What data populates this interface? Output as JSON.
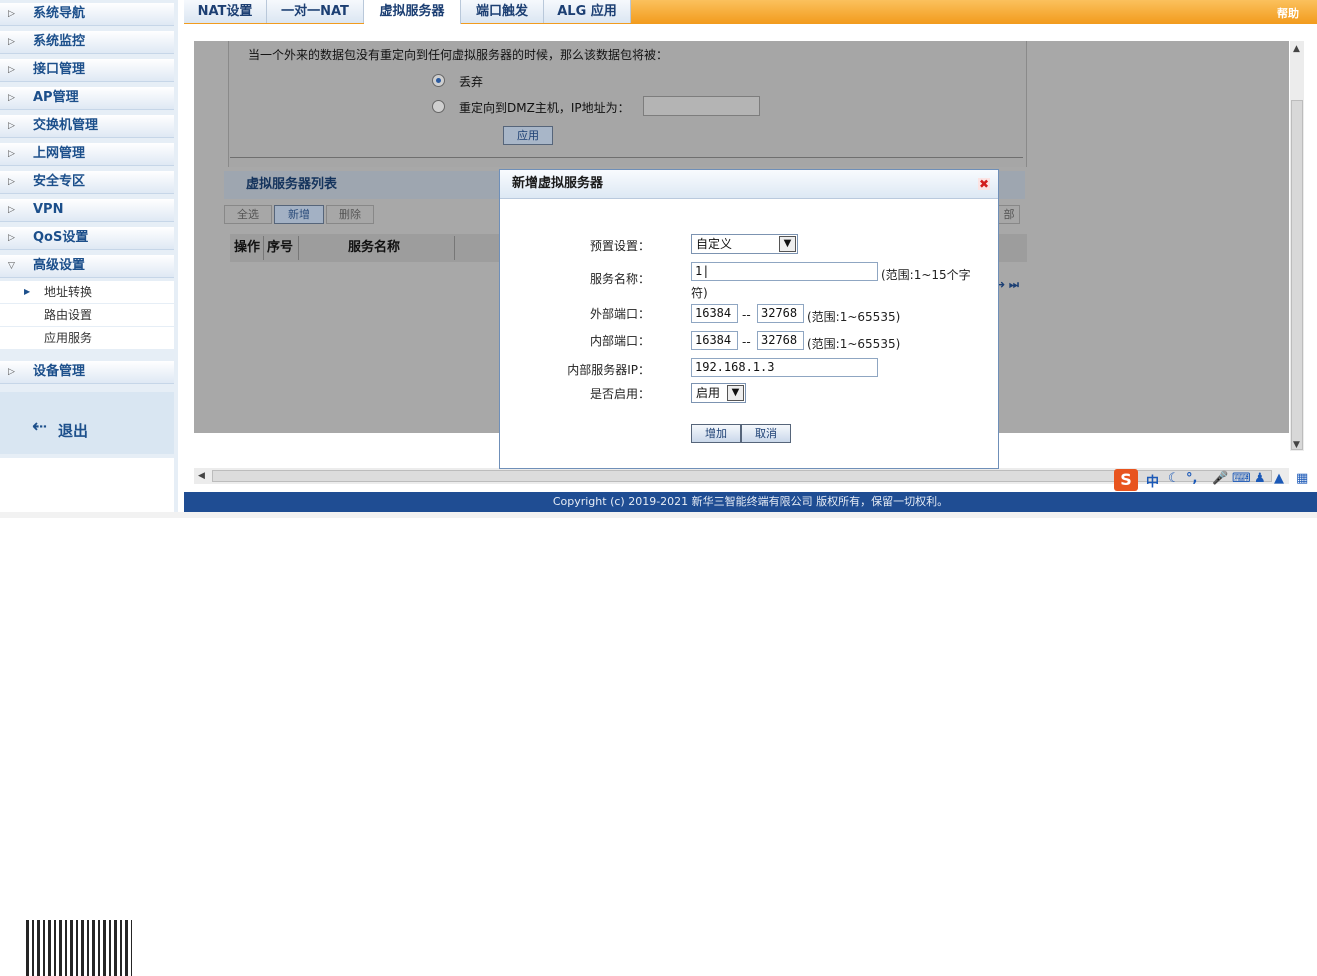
{
  "sidebar": {
    "items": [
      {
        "label": "系统导航"
      },
      {
        "label": "系统监控"
      },
      {
        "label": "接口管理"
      },
      {
        "label": "AP管理"
      },
      {
        "label": "交换机管理"
      },
      {
        "label": "上网管理"
      },
      {
        "label": "安全专区"
      },
      {
        "label": "VPN"
      },
      {
        "label": "QoS设置"
      },
      {
        "label": "高级设置"
      }
    ],
    "sub_items": [
      {
        "label": "地址转换"
      },
      {
        "label": "路由设置"
      },
      {
        "label": "应用服务"
      }
    ],
    "device_mgmt": "设备管理",
    "logout": "退出"
  },
  "tabs": [
    {
      "label": "NAT设置"
    },
    {
      "label": "一对一NAT"
    },
    {
      "label": "虚拟服务器"
    },
    {
      "label": "端口触发"
    },
    {
      "label": "ALG 应用"
    }
  ],
  "help": "帮助",
  "dmz": {
    "prompt": "当一个外来的数据包没有重定向到任何虚拟服务器的时候，那么该数据包将被：",
    "option_drop": "丢弃",
    "option_redirect": "重定向到DMZ主机，IP地址为：",
    "apply": "应用"
  },
  "list": {
    "title": "虚拟服务器列表",
    "btn_select_all": "全选",
    "btn_add": "新增",
    "btn_delete": "删除",
    "btn_right_partial": "部",
    "col_op": "操作",
    "col_no": "序号",
    "col_name": "服务名称",
    "pager": "➜ ⏭"
  },
  "modal": {
    "title": "新增虚拟服务器",
    "preset_label": "预置设置：",
    "preset_value": "自定义",
    "name_label": "服务名称：",
    "name_value": "1|",
    "name_hint_1": "(范围:1~15个字",
    "name_hint_2": "符)",
    "ext_port_label": "外部端口：",
    "ext_port_from": "16384",
    "ext_port_to": "32768",
    "int_port_label": "内部端口：",
    "int_port_from": "16384",
    "int_port_to": "32768",
    "dash": "--",
    "port_hint": "(范围:1~65535)",
    "ip_label": "内部服务器IP：",
    "ip_value": "192.168.1.3",
    "enable_label": "是否启用：",
    "enable_value": "启用",
    "add_button": "增加",
    "cancel_button": "取消"
  },
  "footer": {
    "copyright": "Copyright (c) 2019-2021 新华三智能终端有限公司 版权所有，保留一切权利。"
  },
  "ime": {
    "logo": "S",
    "mode": "中"
  }
}
